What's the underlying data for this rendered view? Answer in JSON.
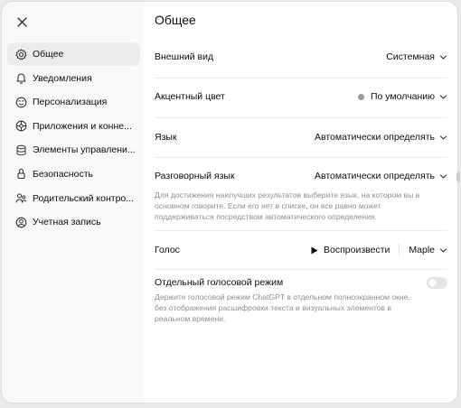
{
  "close": {
    "icon": "close-icon"
  },
  "sidebar": {
    "items": [
      {
        "label": "Общее",
        "icon": "gear-icon",
        "active": true
      },
      {
        "label": "Уведомления",
        "icon": "bell-icon"
      },
      {
        "label": "Персонализация",
        "icon": "personalization-icon"
      },
      {
        "label": "Приложения и конне...",
        "icon": "apps-icon"
      },
      {
        "label": "Элементы управлени...",
        "icon": "data-controls-icon"
      },
      {
        "label": "Безопасность",
        "icon": "shield-icon"
      },
      {
        "label": "Родительский контро...",
        "icon": "parental-icon"
      },
      {
        "label": "Учетная запись",
        "icon": "account-icon"
      }
    ]
  },
  "main": {
    "title": "Общее",
    "appearance": {
      "label": "Внешний вид",
      "value": "Системная"
    },
    "accent": {
      "label": "Акцентный цвет",
      "value": "По умолчанию",
      "color": "#9b9b9b"
    },
    "language": {
      "label": "Язык",
      "value": "Автоматически определять"
    },
    "spoken": {
      "label": "Разговорный язык",
      "value": "Автоматически определять",
      "help": "Для достижения наилучших результатов выберите язык, на котором вы в основном говорите. Если его нет в списке, он все равно может поддерживаться посредством автоматического определения."
    },
    "voice": {
      "label": "Голос",
      "play_label": "Воспроизвести",
      "value": "Maple"
    },
    "separate_voice": {
      "label": "Отдельный голосовой режим",
      "enabled": false,
      "help": "Держите голосовой режим ChatGPT в отдельном полноэкранном окне, без отображения расшифровки текста и визуальных элементов в реальном времени."
    }
  }
}
